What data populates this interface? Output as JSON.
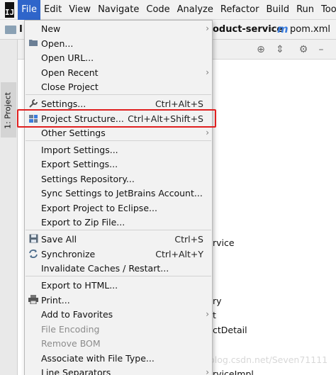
{
  "menubar": {
    "logo": "IJ",
    "items": [
      "File",
      "Edit",
      "View",
      "Navigate",
      "Code",
      "Analyze",
      "Refactor",
      "Build",
      "Run",
      "Tools"
    ]
  },
  "navbar": {
    "first": "I",
    "project_crumb": "oduct-service",
    "file_crumb": "pom.xml",
    "file_icon": "m"
  },
  "tool_window": {
    "tab_label": "1: Project"
  },
  "background": {
    "peek": [
      "rvice",
      "ry",
      "t",
      "ctDetail",
      "rviceImpl"
    ],
    "watermark": "https://blog.csdn.net/Seven71111"
  },
  "file_menu": {
    "items": [
      {
        "label": "New",
        "shortcut": "",
        "submenu": true,
        "icon": ""
      },
      {
        "label": "Open...",
        "shortcut": "",
        "submenu": false,
        "icon": "folder-icon"
      },
      {
        "label": "Open URL...",
        "shortcut": "",
        "submenu": false,
        "icon": ""
      },
      {
        "label": "Open Recent",
        "shortcut": "",
        "submenu": true,
        "icon": ""
      },
      {
        "label": "Close Project",
        "shortcut": "",
        "submenu": false,
        "icon": ""
      },
      {
        "label": "Settings...",
        "shortcut": "Ctrl+Alt+S",
        "submenu": false,
        "icon": "wrench-icon"
      },
      {
        "label": "Project Structure...",
        "shortcut": "Ctrl+Alt+Shift+S",
        "submenu": false,
        "icon": "project-structure-icon"
      },
      {
        "label": "Other Settings",
        "shortcut": "",
        "submenu": true,
        "icon": ""
      },
      {
        "label": "Import Settings...",
        "shortcut": "",
        "submenu": false,
        "icon": ""
      },
      {
        "label": "Export Settings...",
        "shortcut": "",
        "submenu": false,
        "icon": ""
      },
      {
        "label": "Settings Repository...",
        "shortcut": "",
        "submenu": false,
        "icon": ""
      },
      {
        "label": "Sync Settings to JetBrains Account...",
        "shortcut": "",
        "submenu": false,
        "icon": ""
      },
      {
        "label": "Export Project to Eclipse...",
        "shortcut": "",
        "submenu": false,
        "icon": ""
      },
      {
        "label": "Export to Zip File...",
        "shortcut": "",
        "submenu": false,
        "icon": ""
      },
      {
        "label": "Save All",
        "shortcut": "Ctrl+S",
        "submenu": false,
        "icon": "save-icon"
      },
      {
        "label": "Synchronize",
        "shortcut": "Ctrl+Alt+Y",
        "submenu": false,
        "icon": "sync-icon"
      },
      {
        "label": "Invalidate Caches / Restart...",
        "shortcut": "",
        "submenu": false,
        "icon": ""
      },
      {
        "label": "Export to HTML...",
        "shortcut": "",
        "submenu": false,
        "icon": ""
      },
      {
        "label": "Print...",
        "shortcut": "",
        "submenu": false,
        "icon": "print-icon"
      },
      {
        "label": "Add to Favorites",
        "shortcut": "",
        "submenu": true,
        "icon": ""
      },
      {
        "label": "File Encoding",
        "shortcut": "",
        "submenu": false,
        "icon": "",
        "disabled": true
      },
      {
        "label": "Remove BOM",
        "shortcut": "",
        "submenu": false,
        "icon": "",
        "disabled": true
      },
      {
        "label": "Associate with File Type...",
        "shortcut": "",
        "submenu": false,
        "icon": ""
      },
      {
        "label": "Line Separators",
        "shortcut": "",
        "submenu": true,
        "icon": ""
      }
    ]
  }
}
